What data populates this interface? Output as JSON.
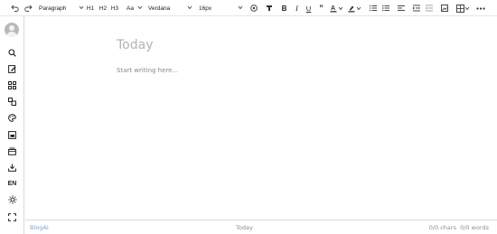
{
  "toolbar": {
    "block_format": "Paragraph",
    "headings": [
      "H1",
      "H2",
      "H3"
    ],
    "font_size_icon_label": "Aa",
    "font_family": "Verdana",
    "font_size": "16px",
    "icons": [
      "undo-icon",
      "redo-icon",
      "emoji-icon",
      "clear-format-icon",
      "bold-icon",
      "italic-icon",
      "underline-icon",
      "blockquote-icon",
      "text-color-icon",
      "highlight-color-icon",
      "numbered-list-icon",
      "bulleted-list-icon",
      "align-left-icon",
      "indent-icon",
      "outdent-icon",
      "insert-image-icon",
      "table-icon",
      "more-icon"
    ]
  },
  "sidebar": {
    "items": [
      "avatar",
      "search-docs-icon",
      "edit-notes-icon",
      "apps-grid-icon",
      "shapes-icon",
      "palette-icon",
      "image-gallery-icon",
      "archive-icon",
      "download-icon",
      "language-switch",
      "theme-toggle-icon",
      "fullscreen-icon"
    ],
    "language": "EN"
  },
  "editor": {
    "title_placeholder": "Today",
    "body_placeholder": "Start writing here..."
  },
  "status": {
    "brand": "BlogAI",
    "date": "Today",
    "chars": "0/0 chars",
    "words": "0/0 words"
  }
}
